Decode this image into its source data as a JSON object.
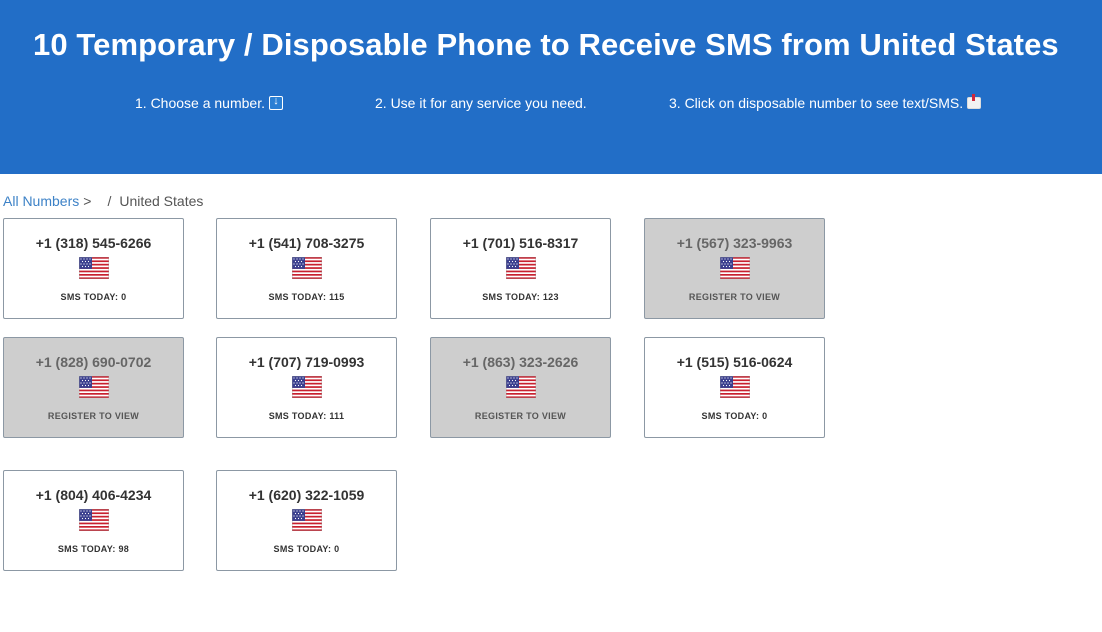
{
  "hero": {
    "title": "10 Temporary / Disposable Phone to Receive SMS from United States",
    "steps": [
      {
        "text": "1. Choose a number.",
        "icon": "down-arrow-icon"
      },
      {
        "text": "2. Use it for any service you need."
      },
      {
        "text": "3. Click on disposable number to see text/SMS.",
        "icon": "inbox-icon"
      }
    ]
  },
  "breadcrumb": {
    "all_numbers": "All Numbers",
    "separator1": ">",
    "separator2": "/",
    "current": "United States"
  },
  "numbers": [
    {
      "phone": "+1 (318) 545-6266",
      "status": "SMS TODAY: 0",
      "locked": false
    },
    {
      "phone": "+1 (541) 708-3275",
      "status": "SMS TODAY: 115",
      "locked": false
    },
    {
      "phone": "+1 (701) 516-8317",
      "status": "SMS TODAY: 123",
      "locked": false
    },
    {
      "phone": "+1 (567) 323-9963",
      "status": "REGISTER TO VIEW",
      "locked": true
    },
    {
      "phone": "+1 (828) 690-0702",
      "status": "REGISTER TO VIEW",
      "locked": true
    },
    {
      "phone": "+1 (707) 719-0993",
      "status": "SMS TODAY: 111",
      "locked": false
    },
    {
      "phone": "+1 (863) 323-2626",
      "status": "REGISTER TO VIEW",
      "locked": true
    },
    {
      "phone": "+1 (515) 516-0624",
      "status": "SMS TODAY: 0",
      "locked": false
    },
    {
      "phone": "+1 (804) 406-4234",
      "status": "SMS TODAY: 98",
      "locked": false
    },
    {
      "phone": "+1 (620) 322-1059",
      "status": "SMS TODAY: 0",
      "locked": false
    }
  ],
  "colors": {
    "hero_bg": "#226ec7",
    "locked_bg": "#cecece",
    "link": "#3d82c7"
  }
}
